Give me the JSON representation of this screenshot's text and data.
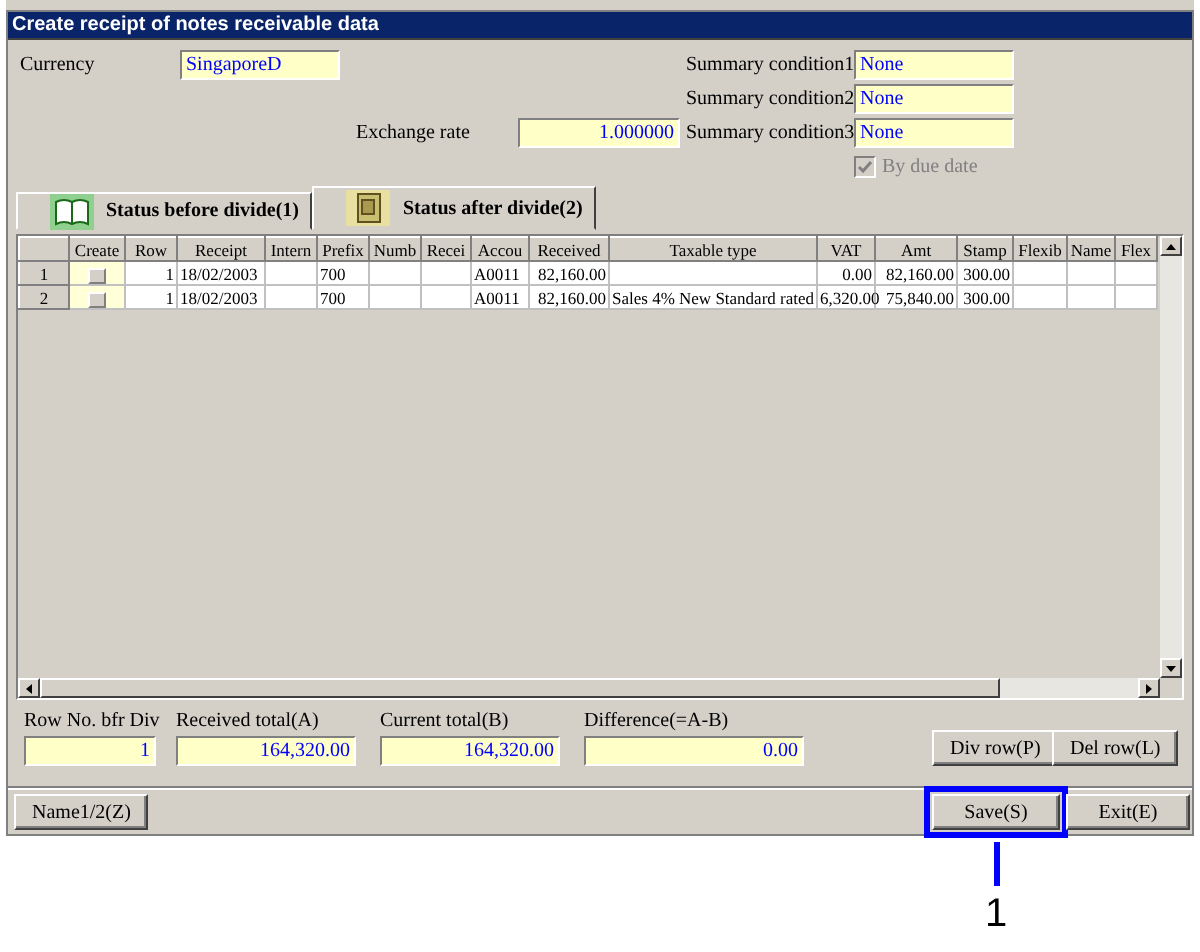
{
  "window": {
    "title": "Create receipt of notes receivable data"
  },
  "header_fields": [
    {
      "label": "Currency",
      "value": "SingaporeD"
    },
    {
      "label": "Summary condition1",
      "value": "None"
    },
    {
      "label": "Summary condition2",
      "value": "None"
    },
    {
      "label": "Exchange rate",
      "value": "1.000000"
    },
    {
      "label": "Summary condition3",
      "value": "None"
    }
  ],
  "by_due_date": {
    "label": "By due date",
    "checked": true,
    "disabled": true
  },
  "tabs": [
    {
      "label": "Status before divide(1)",
      "selected": false
    },
    {
      "label": "Status after divide(2)",
      "selected": true
    }
  ],
  "table": {
    "columns": [
      "Create",
      "Row",
      "Receipt",
      "Intern",
      "Prefix",
      "Numb",
      "Recei",
      "Accou",
      "Received",
      "Taxable type",
      "VAT",
      "Amt",
      "Stamp",
      "Flexib",
      "Name",
      "Flex"
    ],
    "rows": [
      {
        "row_number": "1",
        "create_checked": false,
        "cells": [
          "",
          "1",
          "18/02/2003",
          "",
          "700",
          "",
          "",
          "A0011",
          "82,160.00",
          "",
          "0.00",
          "82,160.00",
          "300.00",
          "",
          "",
          ""
        ]
      },
      {
        "row_number": "2",
        "create_checked": false,
        "cells": [
          "",
          "1",
          "18/02/2003",
          "",
          "700",
          "",
          "",
          "A0011",
          "82,160.00",
          "Sales 4% New Standard rated",
          "6,320.00",
          "75,840.00",
          "300.00",
          "",
          "",
          ""
        ]
      }
    ]
  },
  "totals": [
    {
      "label": "Row No. bfr Div",
      "value": "1"
    },
    {
      "label": "Received total(A)",
      "value": "164,320.00"
    },
    {
      "label": "Current total(B)",
      "value": "164,320.00"
    },
    {
      "label": "Difference(=A-B)",
      "value": "0.00"
    }
  ],
  "row_buttons": [
    "Div row(P)",
    "Del row(L)"
  ],
  "footer": {
    "left_button": "Name1/2(Z)",
    "right_buttons": [
      {
        "label": "Save(S)",
        "highlighted": true
      },
      {
        "label": "Exit(E)",
        "highlighted": false
      }
    ]
  },
  "callout": {
    "label": "1"
  }
}
